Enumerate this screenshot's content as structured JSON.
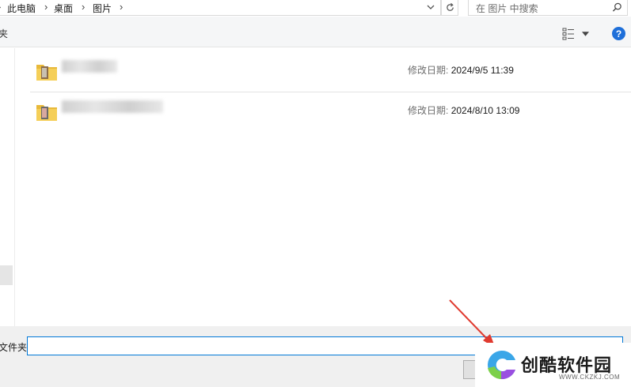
{
  "address_bar": {
    "crumbs": [
      "此电脑",
      "桌面",
      "图片"
    ],
    "separator": "›"
  },
  "search": {
    "placeholder": "在 图片 中搜索"
  },
  "toolbar": {
    "cut_text": "夹",
    "help_label": "?"
  },
  "files": [
    {
      "icon": "folder-icon",
      "name": "",
      "modified_label": "修改日期:",
      "modified_value": "2024/9/5 11:39"
    },
    {
      "icon": "folder-icon",
      "name": "",
      "modified_label": "修改日期:",
      "modified_value": "2024/8/10 13:09"
    }
  ],
  "bottom": {
    "folder_label": "文件夹:",
    "folder_value": ""
  },
  "watermark": {
    "brand": "创酷软件园",
    "url": "WWW.CKZKJ.COM"
  },
  "colors": {
    "accent": "#0078d7",
    "help": "#1e6fd9",
    "arrow": "#e03a2f"
  }
}
